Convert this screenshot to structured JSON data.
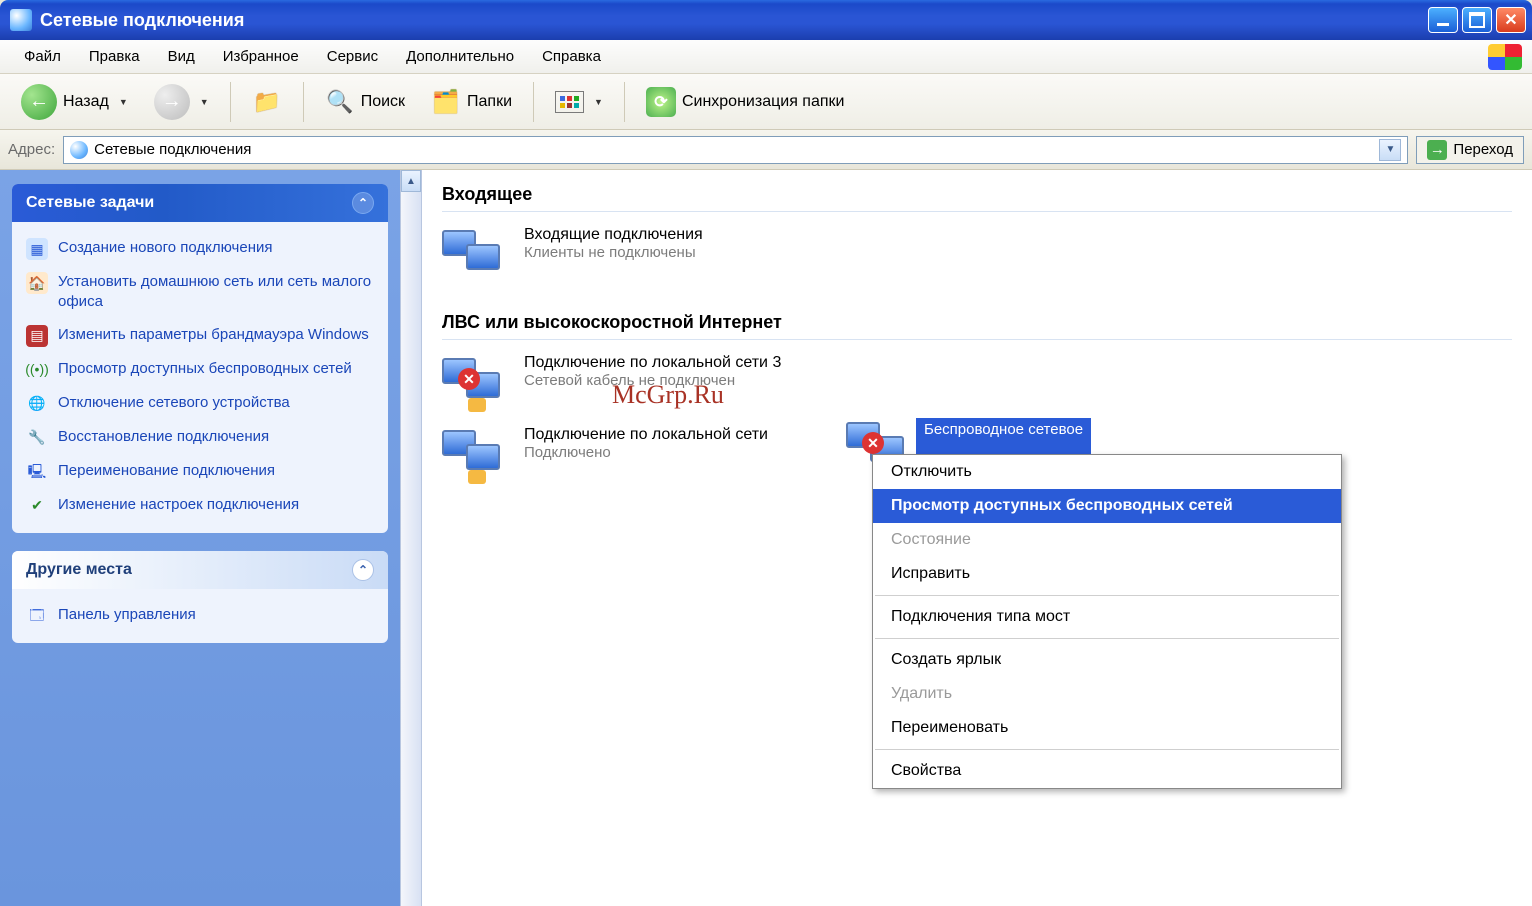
{
  "window": {
    "title": "Сетевые подключения"
  },
  "menu": {
    "file": "Файл",
    "edit": "Правка",
    "view": "Вид",
    "favorites": "Избранное",
    "tools": "Сервис",
    "advanced": "Дополнительно",
    "help": "Справка"
  },
  "toolbar": {
    "back": "Назад",
    "search": "Поиск",
    "folders": "Папки",
    "sync": "Синхронизация папки"
  },
  "address": {
    "label": "Адрес:",
    "value": "Сетевые подключения",
    "go": "Переход"
  },
  "sidebar": {
    "tasks_header": "Сетевые задачи",
    "tasks": [
      "Создание нового подключения",
      "Установить домашнюю сеть или сеть малого офиса",
      "Изменить параметры брандмауэра Windows",
      "Просмотр доступных беспроводных сетей",
      "Отключение сетевого устройства",
      "Восстановление подключения",
      "Переименование подключения",
      "Изменение настроек подключения"
    ],
    "other_header": "Другие места",
    "other": [
      "Панель управления"
    ]
  },
  "groups": {
    "incoming_header": "Входящее",
    "incoming_item_title": "Входящие подключения",
    "incoming_item_sub": "Клиенты не подключены",
    "lan_header": "ЛВС или высокоскоростной Интернет",
    "lan3_title": "Подключение по локальной сети 3",
    "lan3_sub": "Сетевой кабель не подключен",
    "lan_title": "Подключение по локальной сети",
    "lan_sub": "Подключено",
    "wifi_title": "Беспроводное сетевое"
  },
  "ctxmenu": {
    "disable": "Отключить",
    "view_wireless": "Просмотр доступных беспроводных сетей",
    "status": "Состояние",
    "repair": "Исправить",
    "bridge": "Подключения типа мост",
    "shortcut": "Создать ярлык",
    "delete": "Удалить",
    "rename": "Переименовать",
    "properties": "Свойства"
  },
  "watermark": "McGrp.Ru"
}
